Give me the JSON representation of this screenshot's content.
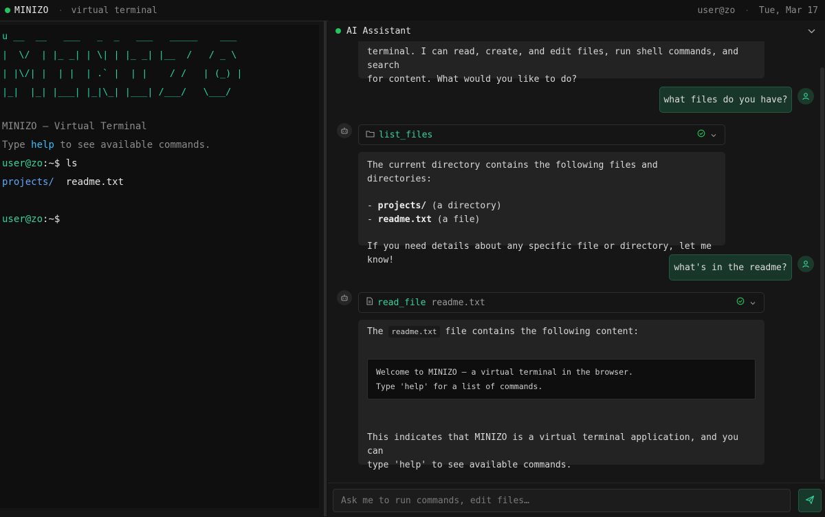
{
  "topbar": {
    "brand": "MINIZO",
    "separator": "·",
    "subtitle": "virtual terminal",
    "user": "user@zo",
    "date": "Tue, Mar 17"
  },
  "terminal": {
    "ascii_banner": "u __  __   ___   _  _   ___   _____    ___\n|  \\/  | |_ _| | \\| | |_ _| |__  /   / _ \\\n| |\\/| |  | |  | .` |  | |    / /   | (_) |\n|_|  |_| |___| |_|\\_| |___| /___/   \\___/",
    "intro": "MINIZO — Virtual Terminal",
    "help_prefix": "Type ",
    "help_word": "help",
    "help_suffix": " to see available commands.",
    "prompt_user": "user@zo",
    "prompt_path": ":~$",
    "command": " ls",
    "ls_dir": "projects/",
    "ls_file": "readme.txt"
  },
  "assistant": {
    "title": "AI Assistant",
    "messages": {
      "intro_line1": "terminal. I can read, create, and edit files, run shell commands, and search",
      "intro_line2": "for content. What would you like to do?",
      "user1": "what files do you have?",
      "tool1_name": "list_files",
      "reply1_line1": "The current directory contains the following files and directories:",
      "reply1_item1_name": "projects/",
      "reply1_item1_desc": " (a directory)",
      "reply1_item2_name": "readme.txt",
      "reply1_item2_desc": " (a file)",
      "reply1_line_end": "If you need details about any specific file or directory, let me know!",
      "user2": "what's in the readme?",
      "tool2_name": "read_file",
      "tool2_arg": "readme.txt",
      "reply2_pre": "The ",
      "reply2_code": "readme.txt",
      "reply2_post": " file contains the following content:",
      "code_line1": "Welcome to MINIZO — a virtual terminal in the browser.",
      "code_line2": "Type 'help' for a list of commands.",
      "reply2_end1": "This indicates that MINIZO is a virtual terminal application, and you can",
      "reply2_end2": "type 'help' to see available commands."
    },
    "input_placeholder": "Ask me to run commands, edit files…",
    "dash": "- "
  },
  "colors": {
    "accent": "#22c55e",
    "tool_name": "#34d399",
    "user_bubble": "#18362a",
    "terminal_bg": "#0f0f0f"
  }
}
